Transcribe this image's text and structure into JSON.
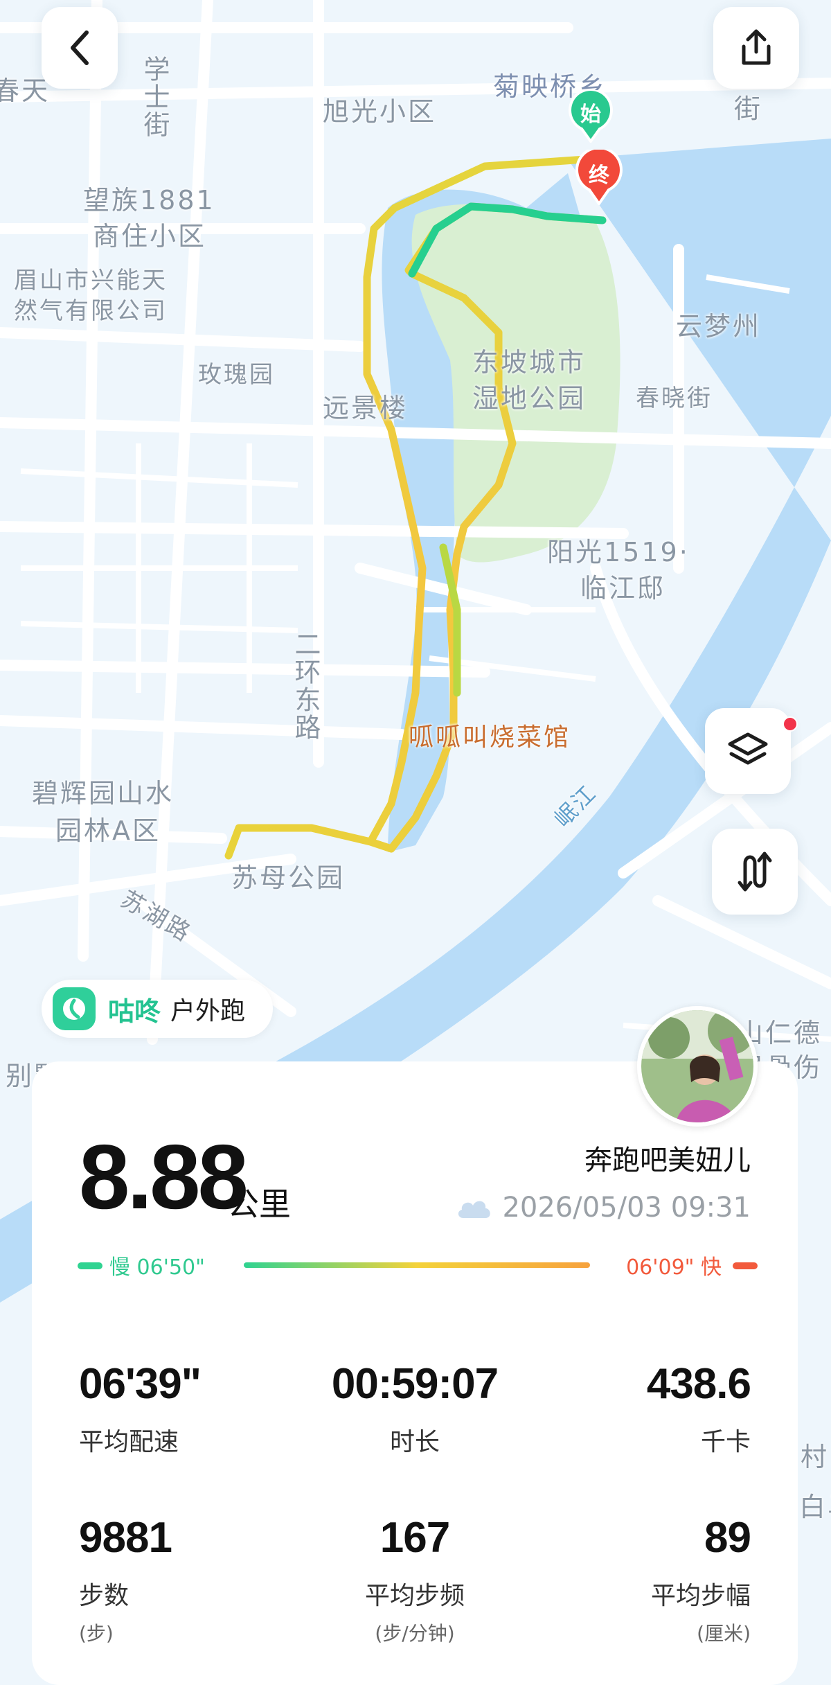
{
  "map": {
    "labels": {
      "chunyan": "春天",
      "xueshi_jie": "学士街",
      "xuguang": "旭光小区",
      "juying": "菊映桥乡",
      "jie_top": "街",
      "wangzu": "望族1881",
      "wangzu2": "商住小区",
      "meishan_gas1": "眉山市兴能天",
      "meishan_gas2": "然气有限公司",
      "meigui": "玫瑰园",
      "yuanjing": "远景楼",
      "dongpo1": "东坡城市",
      "dongpo2": "湿地公园",
      "yunmeng": "云梦州",
      "chunxiao": "春晓街",
      "yangguang1": "阳光1519·",
      "yangguang2": "临江邸",
      "erhuan": "二环东路",
      "guagua": "呱呱叫烧菜馆",
      "minjiang": "岷江",
      "bihui1": "碧辉园山水",
      "bihui2": "园林A区",
      "sumu": "苏母公园",
      "suhu": "苏湖路",
      "shanren1": "山仁德",
      "shanren2": "眉骨伤",
      "bie": "别墅",
      "cun": "村",
      "baima": "白马"
    },
    "start_marker": "始",
    "end_marker": "终"
  },
  "buttons": {
    "back_icon": "chevron-left-icon",
    "share_icon": "share-icon",
    "layers_icon": "layers-icon",
    "route_icon": "route-icon"
  },
  "brand": {
    "name": "咕咚",
    "activity": "户外跑"
  },
  "summary": {
    "distance": "8.88",
    "distance_unit": "公里",
    "user_name": "奔跑吧美妞儿",
    "weather_icon": "cloud-icon",
    "datetime": "2026/05/03 09:31",
    "pace_slow": "慢 06'50\"",
    "pace_fast": "06'09\" 快",
    "colors": {
      "slow": "#2fd391",
      "mid": "#f4d23a",
      "fast": "#f25a3c"
    }
  },
  "stats": [
    {
      "value": "06'39\"",
      "label": "平均配速",
      "unit": ""
    },
    {
      "value": "00:59:07",
      "label": "时长",
      "unit": ""
    },
    {
      "value": "438.6",
      "label": "千卡",
      "unit": ""
    },
    {
      "value": "9881",
      "label": "步数",
      "unit": "(步)"
    },
    {
      "value": "167",
      "label": "平均步频",
      "unit": "(步/分钟)"
    },
    {
      "value": "89",
      "label": "平均步幅",
      "unit": "(厘米)"
    }
  ]
}
